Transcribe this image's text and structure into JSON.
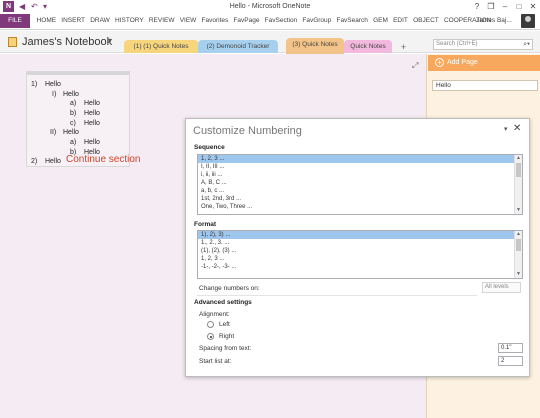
{
  "window": {
    "title": "Hello - Microsoft OneNote",
    "app_logo": "N",
    "quick_access": [
      "back-icon",
      "undo-icon",
      "customize-icon"
    ],
    "controls": {
      "help": "?",
      "restore": "❐",
      "minimize": "–",
      "maximize": "□",
      "close": "✕"
    }
  },
  "ribbon": {
    "file_tab": "FILE",
    "tabs": [
      "HOME",
      "INSERT",
      "DRAW",
      "HISTORY",
      "REVIEW",
      "VIEW",
      "Favorites",
      "FavPage",
      "FavSection",
      "FavGroup",
      "FavSearch",
      "GEM",
      "EDIT",
      "OBJECT",
      "COOPERATION"
    ],
    "user": "James Baj..."
  },
  "notebook": {
    "name": "James's Notebook",
    "sections": [
      {
        "label": "(1) (1) Quick Notes",
        "color": "#f6d57d"
      },
      {
        "label": "(2) Demonoid Tracker",
        "color": "#a7d0ee"
      },
      {
        "label": "(3) Quick Notes",
        "color": "#f2c48a"
      },
      {
        "label": "Quick Notes",
        "color": "#f3b8de"
      }
    ],
    "add_tab": "+",
    "search_placeholder": "Search (Ctrl+E)"
  },
  "outline": {
    "items": [
      {
        "num": "1)",
        "text": "Hello"
      },
      {
        "num": "I)",
        "text": "Hello"
      },
      {
        "num": "a)",
        "text": "Hello"
      },
      {
        "num": "b)",
        "text": "Hello"
      },
      {
        "num": "c)",
        "text": "Hello"
      },
      {
        "num": "II)",
        "text": "Hello"
      },
      {
        "num": "a)",
        "text": "Hello"
      },
      {
        "num": "b)",
        "text": "Hello"
      },
      {
        "num": "2)",
        "text": "Hello"
      }
    ],
    "continue_label": "Continue section"
  },
  "pages_pane": {
    "add_page": "Add Page",
    "pages": [
      "Hello"
    ]
  },
  "dialog": {
    "title": "Customize Numbering",
    "sequence_label": "Sequence",
    "sequence_options": [
      "1, 2, 3 ...",
      "I, II, III ...",
      "i, ii, iii ...",
      "A, B, C ...",
      "a, b, c ...",
      "1st, 2nd, 3rd ...",
      "One, Two, Three ..."
    ],
    "sequence_selected": 0,
    "format_label": "Format",
    "format_options": [
      "1), 2), 3) ...",
      "1., 2., 3. ...",
      "(1), (2), (3) ...",
      "1, 2, 3 ...",
      "-1-, -2-, -3- ..."
    ],
    "format_selected": 0,
    "change_numbers_label": "Change numbers on:",
    "change_numbers_value": "All levels",
    "advanced_label": "Advanced settings",
    "alignment_label": "Alignment:",
    "align_left": "Left",
    "align_right": "Right",
    "alignment_value": "Right",
    "spacing_label": "Spacing from text:",
    "spacing_value": "0.1\"",
    "start_label": "Start list at:",
    "start_value": "2"
  },
  "colors": {
    "onenote_purple": "#80397b",
    "page_background": "#f5ecf3",
    "pages_pane": "#fdf2e1",
    "add_page_bar": "#f7a85c",
    "list_selection": "#9fc7ee",
    "continue_text": "#c5452b"
  }
}
